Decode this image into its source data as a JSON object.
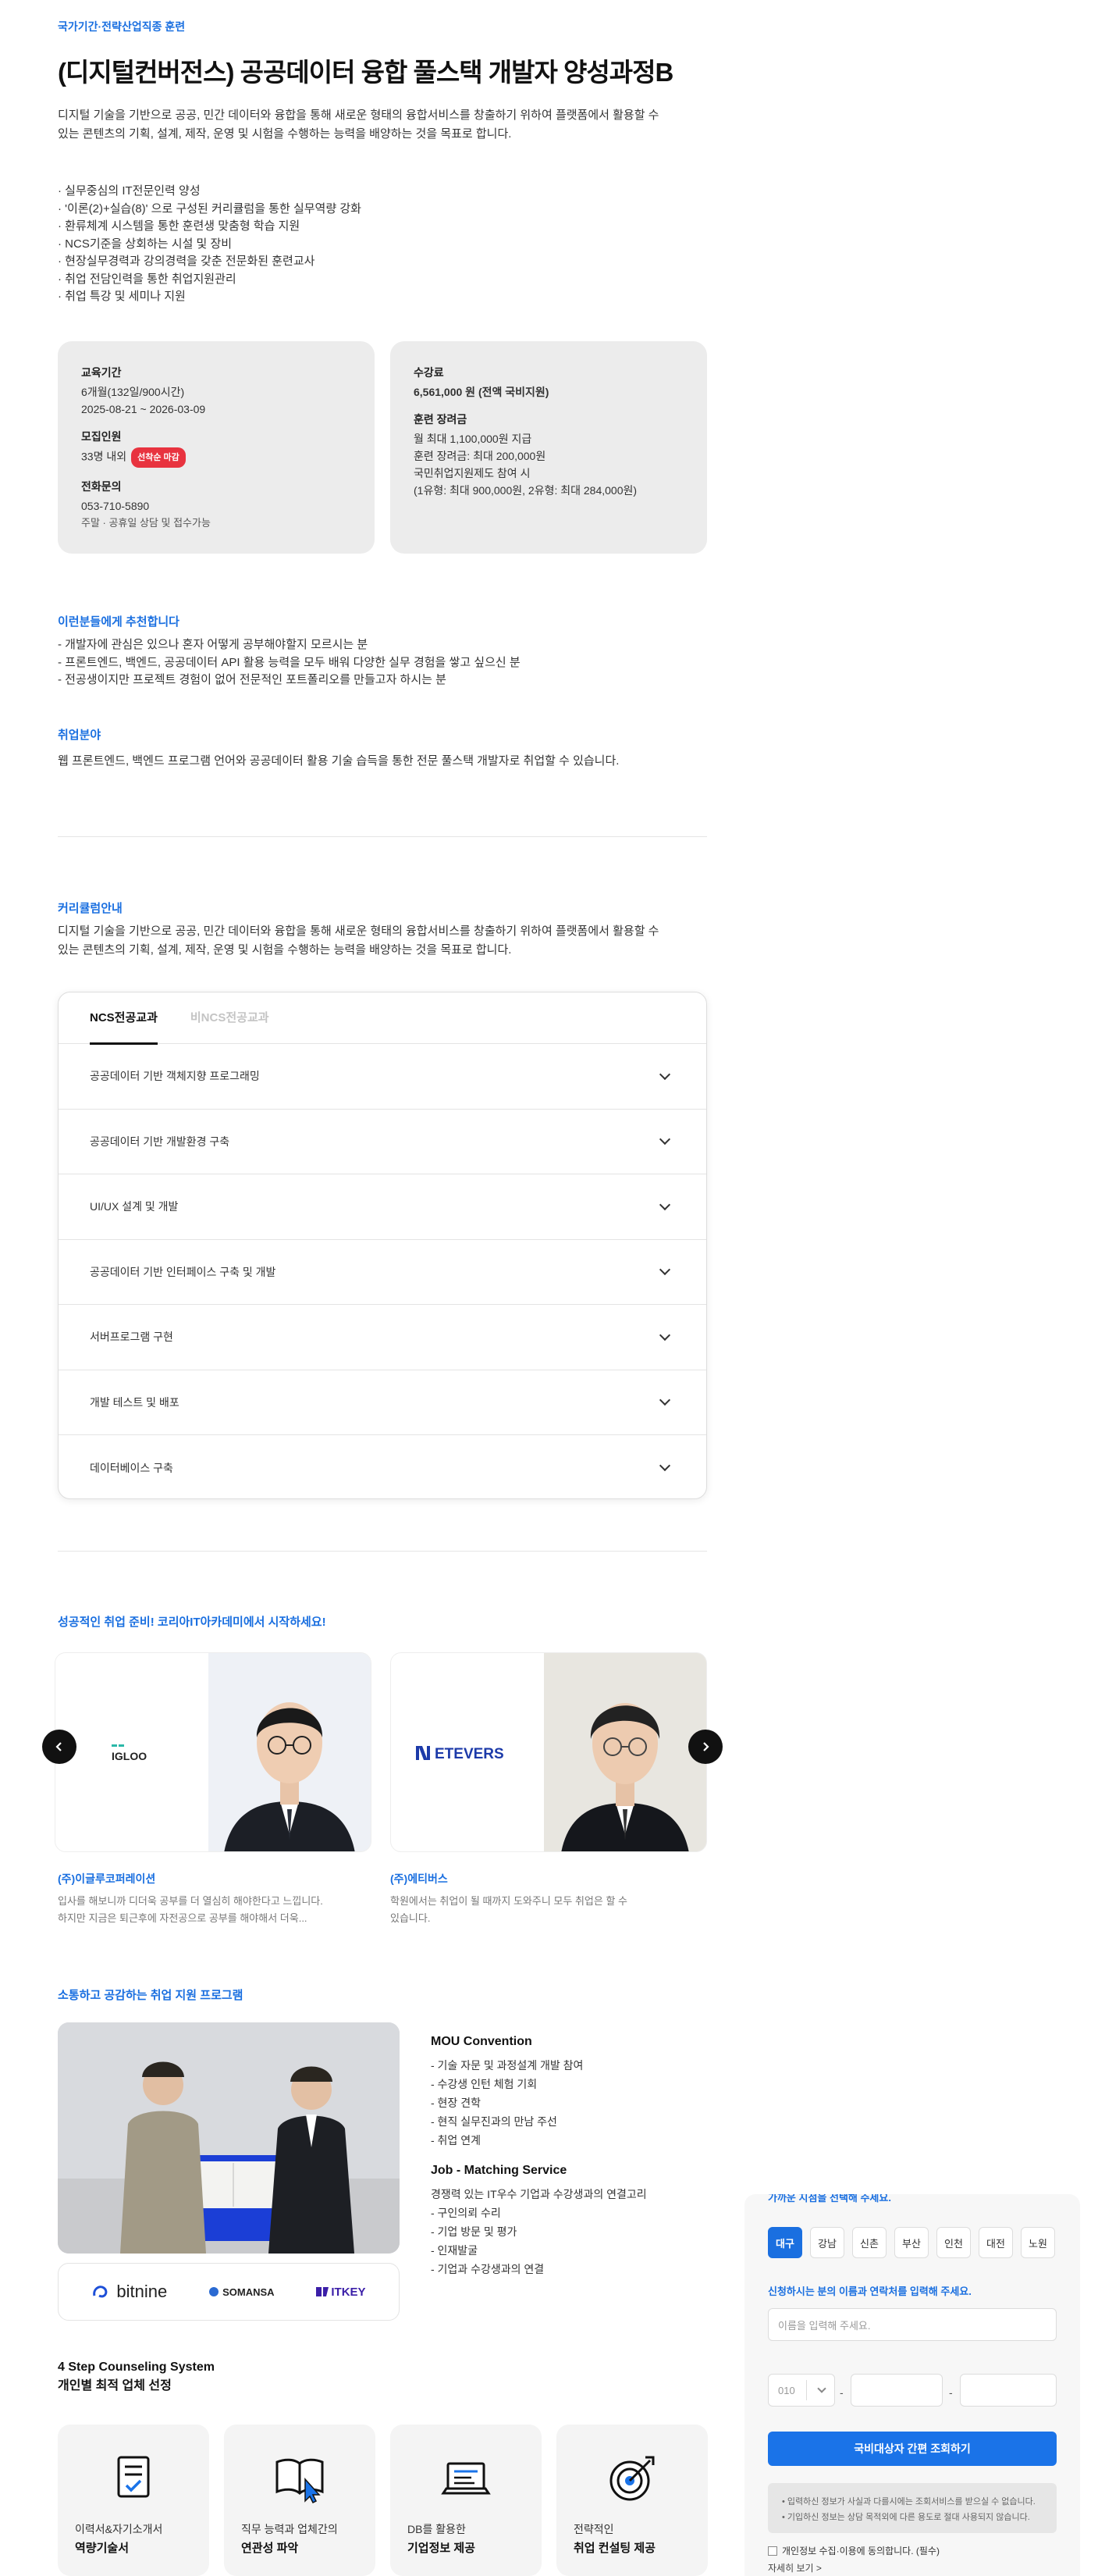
{
  "course": {
    "category": "국가기간·전략산업직종 훈련",
    "title": "(디지털컨버전스) 공공데이터 융합 풀스택 개발자 양성과정B",
    "description_lines": [
      "디지털 기술을 기반으로 공공, 민간 데이터와 융합을 통해 새로운 형태의 융합서비스를 창출하기 위하여 플랫폼에서 활용할 수",
      "있는 콘텐츠의 기획, 설계, 제작, 운영 및 시험을 수행하는 능력을 배양하는 것을 목표로 합니다."
    ],
    "highlights": [
      "· 실무중심의 IT전문인력 양성",
      "· '이론(2)+실습(8)' 으로 구성된 커리큘럼을 통한 실무역량 강화",
      "· 환류체계 시스템을 통한 훈련생 맞춤형 학습 지원",
      "· NCS기준을 상회하는 시설 및 장비",
      "· 현장실무경력과 강의경력을 갖춘 전문화된 훈련교사",
      "· 취업 전담인력을 통한 취업지원관리",
      "· 취업 특강 및 세미나 지원"
    ]
  },
  "info_left": {
    "period_label": "교육기간",
    "period_value1": "6개월(132일/900시간)",
    "period_value2": "2025-08-21 ~ 2026-03-09",
    "recruit_label": "모집인원",
    "recruit_value": "33명 내외",
    "recruit_badge": "선착순 마감",
    "contact_label": "전화문의",
    "contact_phone": "053-710-5890",
    "contact_note": "주말 · 공휴일 상담 및 접수가능"
  },
  "info_right": {
    "fee_label": "수강료",
    "fee_value": "6,561,000 원 (전액 국비지원)",
    "incentive_label": "훈련 장려금",
    "incentive_lines": [
      "월 최대 1,100,000원 지급",
      "훈련 장려금: 최대 200,000원",
      "국민취업지원제도 참여 시",
      "(1유형: 최대 900,000원, 2유형: 최대 284,000원)"
    ]
  },
  "recommend": {
    "heading": "이런분들에게 추천합니다",
    "items": [
      "- 개발자에 관심은 있으나 혼자 어떻게 공부해야할지 모르시는 분",
      "- 프론트엔드, 백엔드, 공공데이터 API 활용 능력을 모두 배워 다양한 실무 경험을 쌓고 싶으신 분",
      "- 전공생이지만 프로젝트 경험이 없어 전문적인 포트폴리오를 만들고자 하시는 분"
    ]
  },
  "career": {
    "heading": "취업분야",
    "text": "웹 프론트엔드, 백엔드 프로그램 언어와 공공데이터 활용 기술 습득을 통한 전문 풀스택 개발자로 취업할 수 있습니다."
  },
  "curriculum": {
    "heading": "커리큘럼안내",
    "description_lines": [
      "디지털 기술을 기반으로 공공, 민간 데이터와 융합을 통해 새로운 형태의 융합서비스를 창출하기 위하여 플랫폼에서 활용할 수",
      "있는 콘텐츠의 기획, 설계, 제작, 운영 및 시험을 수행하는 능력을 배양하는 것을 목표로 합니다."
    ],
    "tabs": [
      "NCS전공교과",
      "비NCS전공교과"
    ],
    "items": [
      "공공데이터 기반 객체지향 프로그래밍",
      "공공데이터 기반 개발환경 구축",
      "UI/UX 설계 및 개발",
      "공공데이터 기반 인터페이스 구축 및 개발",
      "서버프로그램 구현",
      "개발 테스트 및 배포",
      "데이터베이스 구축"
    ]
  },
  "stories": {
    "heading": "성공적인 취업 준비! 코리아IT아카데미에서 시작하세요!",
    "items": [
      {
        "logo": "IGLOO",
        "company": "(주)이글루코퍼레이션",
        "text1": "입사를 해보니까 디더욱 공부를 더 열심히 해야한다고 느낍니다.",
        "text2": "하지만 지금은 퇴근후에 자전공으로 공부를 해야해서 더욱..."
      },
      {
        "logo": "ETEVERS",
        "company": "(주)에티버스",
        "text1": "학원에서는 취업이 될 때까지 도와주니 모두 취업은 할 수",
        "text2": "있습니다."
      }
    ]
  },
  "support": {
    "heading": "소통하고 공감하는 취업 지원 프로그램",
    "logos": [
      "bitnine",
      "SOMANSA",
      "ITKEY"
    ],
    "mou_title": "MOU Convention",
    "mou_items": [
      "- 기술 자문 및 과정설계 개발 참여",
      "- 수강생 인턴 체험 기회",
      "- 현장 견학",
      "- 현직 실무진과의 만남 주선",
      "- 취업 연계"
    ],
    "matching_title": "Job - Matching Service",
    "matching_intro": "경쟁력 있는 IT우수 기업과 수강생과의 연결고리",
    "matching_items": [
      "- 구인의뢰 수리",
      "- 기업 방문 및 평가",
      "- 인재발굴",
      "- 기업과 수강생과의 연결"
    ]
  },
  "steps": {
    "title1": "4 Step Counseling System",
    "title2": "개인별 최적 업체 선정",
    "items": [
      {
        "icon": "document-icon",
        "line1": "이력서&자기소개서",
        "line2": "역량기술서"
      },
      {
        "icon": "book-cursor-icon",
        "line1": "직무 능력과 업체간의",
        "line2": "연관성 파악"
      },
      {
        "icon": "laptop-icon",
        "line1": "DB를 활용한",
        "line2": "기업정보 제공"
      },
      {
        "icon": "target-icon",
        "line1": "전략적인",
        "line2": "취업 컨설팅 제공"
      }
    ]
  },
  "apply_panel": {
    "cut_heading": "가까운 지점을 선택해 주세요.",
    "regions": [
      "대구",
      "강남",
      "신촌",
      "부산",
      "인천",
      "대전",
      "노원"
    ],
    "selected_region": "대구",
    "instruction": "신청하시는 분의 이름과 연락처를 입력해 주세요.",
    "name_placeholder": "이름을 입력해 주세요.",
    "phone_prefix": "010",
    "submit_label": "국비대상자 간편 조회하기",
    "notice1": "• 입력하신 정보가 사실과 다를시에는 조회서비스를 받으실 수 없습니다.",
    "notice2": "• 기입하신 정보는 상담 목적외에 다른 용도로 절대 사용되지 않습니다.",
    "agree_label": "개인정보 수집·이용에 동의합니다. (필수)",
    "more_label": "자세히 보기 >"
  },
  "colors": {
    "accent": "#1a73e8",
    "badge": "#e8333f",
    "card_bg": "#ececec"
  }
}
